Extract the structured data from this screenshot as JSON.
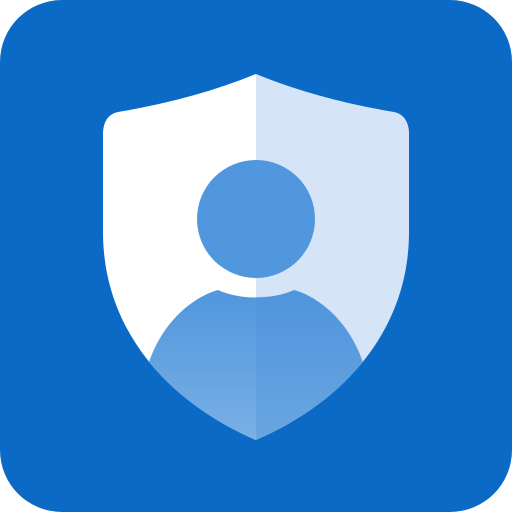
{
  "icon": {
    "name": "user-shield",
    "colors": {
      "background": "#0A6AC6",
      "shield_left": "#FFFFFF",
      "shield_right": "#D6E4F8",
      "avatar": "#5097DD",
      "avatar_light": "#7FB3E6"
    }
  }
}
